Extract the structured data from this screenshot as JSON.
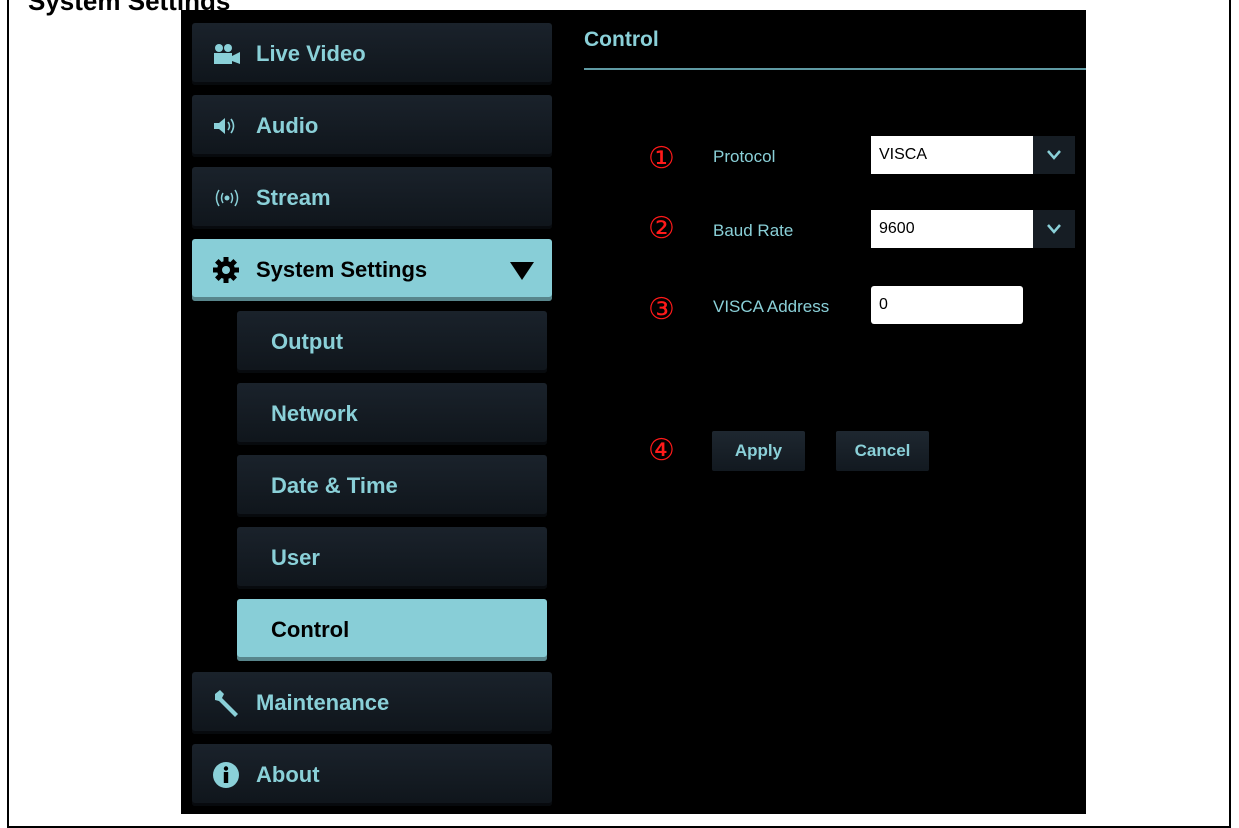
{
  "header_partial": "System Settings",
  "sidebar": {
    "items": [
      {
        "label": "Live Video",
        "icon": "video-camera-icon"
      },
      {
        "label": "Audio",
        "icon": "speaker-icon"
      },
      {
        "label": "Stream",
        "icon": "broadcast-icon"
      },
      {
        "label": "System Settings",
        "icon": "gear-icon",
        "expanded": true,
        "active": true
      },
      {
        "label": "Maintenance",
        "icon": "wrench-icon"
      },
      {
        "label": "About",
        "icon": "info-icon"
      }
    ],
    "subitems": [
      {
        "label": "Output"
      },
      {
        "label": "Network"
      },
      {
        "label": "Date & Time"
      },
      {
        "label": "User"
      },
      {
        "label": "Control",
        "active": true
      }
    ]
  },
  "main": {
    "title": "Control",
    "markers": [
      "①",
      "②",
      "③",
      "④"
    ],
    "protocol": {
      "label": "Protocol",
      "value": "VISCA"
    },
    "baud_rate": {
      "label": "Baud Rate",
      "value": "9600"
    },
    "visca_address": {
      "label": "VISCA Address",
      "value": "0"
    },
    "apply_label": "Apply",
    "cancel_label": "Cancel"
  },
  "colors": {
    "accent": "#88ced7",
    "text_accent": "#8ad0d8",
    "marker": "#ff1a1a",
    "background": "#000000"
  }
}
